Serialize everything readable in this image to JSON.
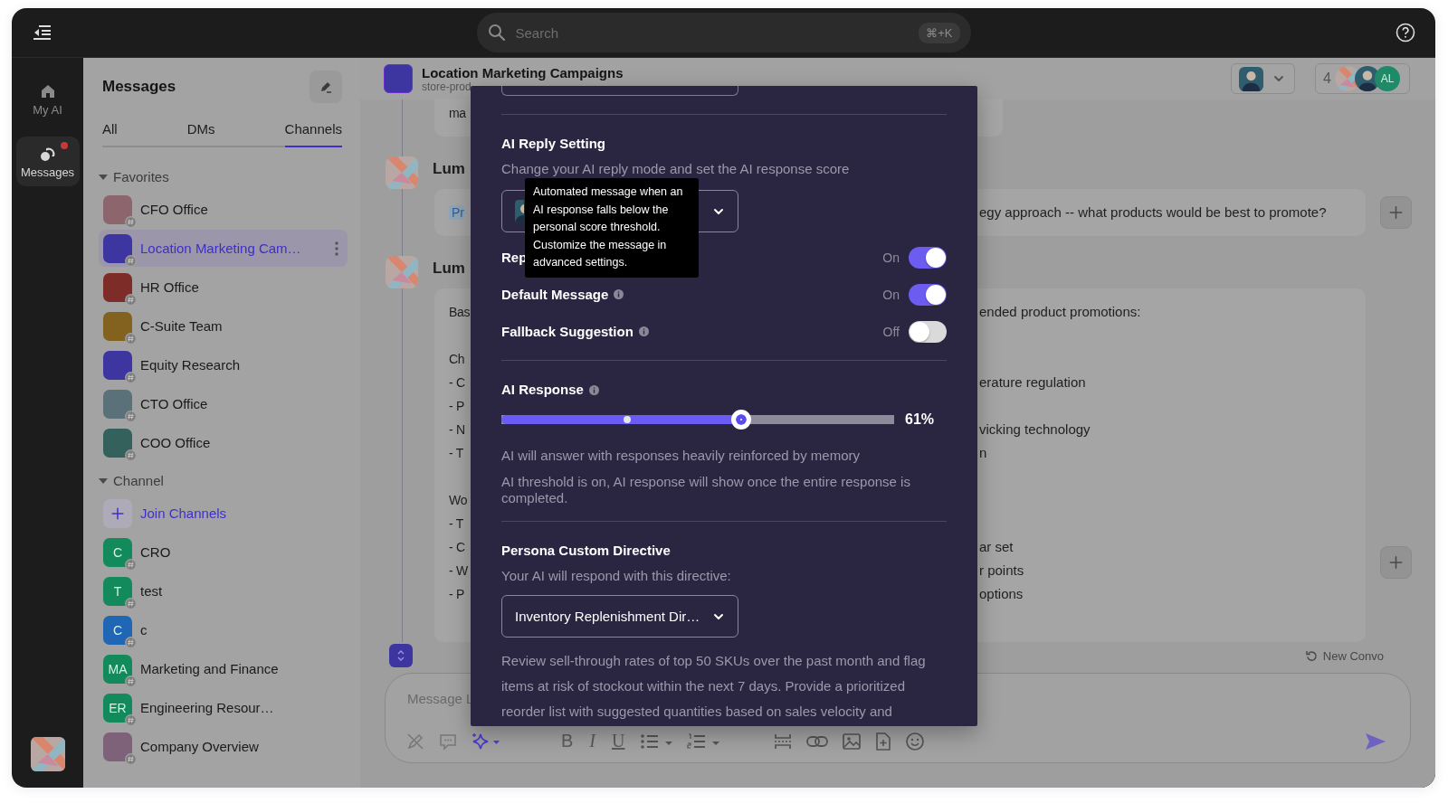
{
  "topbar": {
    "search": {
      "placeholder": "Search",
      "shortcut": "⌘+K"
    }
  },
  "rail": {
    "items": [
      {
        "label": "My AI",
        "selected": false,
        "unread": false
      },
      {
        "label": "Messages",
        "selected": true,
        "unread": true
      }
    ]
  },
  "sidebar": {
    "title": "Messages",
    "tabs": [
      {
        "label": "All",
        "selected": false
      },
      {
        "label": "DMs",
        "selected": false
      },
      {
        "label": "Channels",
        "selected": true
      }
    ],
    "sections": [
      {
        "title": "Favorites",
        "expanded": true,
        "items": [
          {
            "kind": "channel",
            "name": "CFO Office",
            "color": "#8c656d",
            "selected": false
          },
          {
            "kind": "channel",
            "name": "Location Marketing Cam…",
            "color": "#3d35a0",
            "selected": true
          },
          {
            "kind": "channel",
            "name": "HR Office",
            "color": "#7d2c28",
            "selected": false
          },
          {
            "kind": "channel",
            "name": "C-Suite Team",
            "color": "#83611e",
            "selected": false
          },
          {
            "kind": "channel",
            "name": "Equity Research",
            "color": "#3d35a0",
            "selected": false
          },
          {
            "kind": "channel",
            "name": "CTO Office",
            "color": "#5a717a",
            "selected": false
          },
          {
            "kind": "channel",
            "name": "COO Office",
            "color": "#35615c",
            "selected": false
          }
        ]
      },
      {
        "title": "Channel",
        "expanded": true,
        "items": [
          {
            "kind": "join",
            "name": "Join Channels",
            "selected": false
          },
          {
            "kind": "channel",
            "name": "CRO",
            "initials": "C",
            "color": "#138a5b",
            "selected": false
          },
          {
            "kind": "channel",
            "name": "test",
            "initials": "T",
            "color": "#138a5b",
            "selected": false
          },
          {
            "kind": "channel",
            "name": "c",
            "initials": "C",
            "color": "#1f67b5",
            "selected": false
          },
          {
            "kind": "channel",
            "name": "Marketing and Finance",
            "initials": "MA",
            "color": "#138a5b",
            "selected": false
          },
          {
            "kind": "channel",
            "name": "Engineering Resour…",
            "initials": "ER",
            "color": "#138a5b",
            "selected": false
          },
          {
            "kind": "channel",
            "name": "Company Overview",
            "color": "#7e6279",
            "selected": false
          }
        ]
      }
    ]
  },
  "channel": {
    "title": "Location Marketing Campaigns",
    "subtitle": "store-prod",
    "members": {
      "count": "4",
      "avatars": [
        {
          "kind": "logo"
        },
        {
          "kind": "photo"
        },
        {
          "kind": "initials",
          "initials": "AL",
          "color": "#1f8a68"
        }
      ]
    }
  },
  "thread": {
    "messages": [
      {
        "kind": "card",
        "lines": [
          {
            "left": "ma"
          }
        ]
      },
      {
        "kind": "author",
        "name": "Lum"
      },
      {
        "kind": "card",
        "tag": "Pr",
        "add_button": true,
        "lines": [
          {
            "right": "egy approach -- what products would be best to promote?"
          }
        ]
      },
      {
        "kind": "author",
        "name": "Lum"
      },
      {
        "kind": "card",
        "add_button": true,
        "lines": [
          {
            "left": "Bas",
            "right": "ended product promotions:"
          },
          {
            "left": "Ch",
            "spaced": true
          },
          {
            "left": "- C",
            "right": "erature regulation"
          },
          {
            "left": "- P"
          },
          {
            "left": "- N",
            "right": "vicking technology"
          },
          {
            "left": "- T",
            "right": "n"
          },
          {
            "left": "Wo",
            "spaced": true
          },
          {
            "left": "- T"
          },
          {
            "left": "- C",
            "right": "ar set"
          },
          {
            "left": "- W",
            "right": "r points"
          },
          {
            "left": "- P",
            "right": "options"
          }
        ]
      }
    ]
  },
  "composer": {
    "new_convo": "New Convo",
    "placeholder": "Message L",
    "format_marks": [
      "B",
      "I",
      "U"
    ]
  },
  "ai_settings": {
    "reply": {
      "title": "AI Reply Setting",
      "description": "Change your AI reply mode and set the AI response score"
    },
    "tooltip": "Automated message when an AI response falls below the personal score threshold. Customize the message in advanced settings.",
    "toggles": [
      {
        "label": "Rep",
        "state_label": "On",
        "on": true,
        "info": false
      },
      {
        "label": "Default Message",
        "state_label": "On",
        "on": true,
        "info": true
      },
      {
        "label": "Fallback Suggestion",
        "state_label": "Off",
        "on": false,
        "info": true
      }
    ],
    "response": {
      "title": "AI Response",
      "level": 0.61,
      "marker": {
        "level": 0.32
      },
      "reading": "61%",
      "notes": [
        "AI will answer with responses heavily reinforced by memory",
        "AI threshold is on, AI response will show once the entire response is completed."
      ]
    },
    "directive": {
      "title": "Persona Custom Directive",
      "description": "Your AI will respond with this directive:",
      "value": "Inventory Replenishment Dir…",
      "text": "Review sell-through rates of top 50 SKUs over the past month and flag items at risk of stockout within the next 7 days. Provide a prioritized reorder list with suggested quantities based on sales velocity and"
    }
  }
}
